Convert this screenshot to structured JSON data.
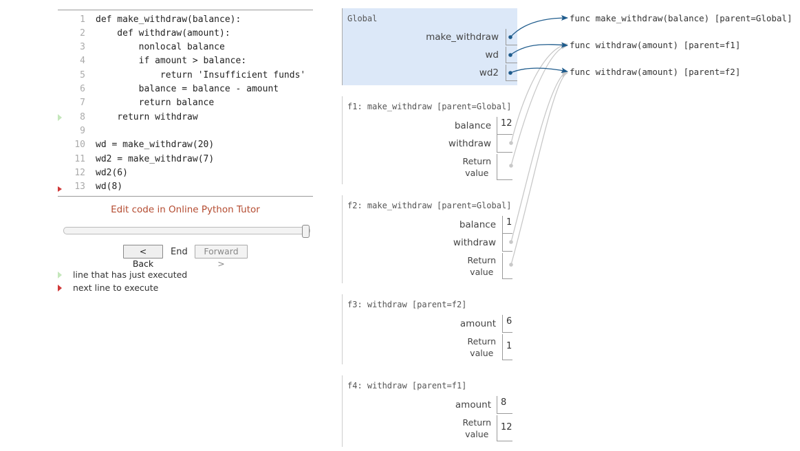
{
  "code": {
    "lines": [
      {
        "no": "1",
        "text": "def make_withdraw(balance):"
      },
      {
        "no": "2",
        "text": "    def withdraw(amount):"
      },
      {
        "no": "3",
        "text": "        nonlocal balance"
      },
      {
        "no": "4",
        "text": "        if amount > balance:"
      },
      {
        "no": "5",
        "text": "            return 'Insufficient funds'"
      },
      {
        "no": "6",
        "text": "        balance = balance - amount"
      },
      {
        "no": "7",
        "text": "        return balance"
      },
      {
        "no": "8",
        "text": "    return withdraw"
      },
      {
        "no": "9",
        "text": ""
      },
      {
        "no": "10",
        "text": "wd = make_withdraw(20)"
      },
      {
        "no": "11",
        "text": "wd2 = make_withdraw(7)"
      },
      {
        "no": "12",
        "text": "wd2(6)"
      },
      {
        "no": "13",
        "text": "wd(8)"
      }
    ]
  },
  "edit_link": "Edit code in Online Python Tutor",
  "nav": {
    "back": "< Back",
    "status": "End",
    "forward": "Forward >",
    "progress": 1.0
  },
  "legend": {
    "just_executed": "line that has just executed",
    "next_line": "next line to execute"
  },
  "frames": {
    "global": {
      "title": "Global",
      "vars": [
        "make_withdraw",
        "wd",
        "wd2"
      ]
    },
    "f1": {
      "title": "f1: make_withdraw [parent=Global]",
      "balance_label": "balance",
      "balance_value": "12",
      "withdraw_label": "withdraw",
      "return_label_1": "Return",
      "return_label_2": "value"
    },
    "f2": {
      "title": "f2: make_withdraw [parent=Global]",
      "balance_label": "balance",
      "balance_value": "1",
      "withdraw_label": "withdraw",
      "return_label_1": "Return",
      "return_label_2": "value"
    },
    "f3": {
      "title": "f3: withdraw [parent=f2]",
      "amount_label": "amount",
      "amount_value": "6",
      "return_label_1": "Return",
      "return_label_2": "value",
      "return_value": "1"
    },
    "f4": {
      "title": "f4: withdraw [parent=f1]",
      "amount_label": "amount",
      "amount_value": "8",
      "return_label_1": "Return",
      "return_label_2": "value",
      "return_value": "12"
    }
  },
  "objects": {
    "make_withdraw_func": "func make_withdraw(balance) [parent=Global]",
    "withdraw_f1_func": "func withdraw(amount) [parent=f1]",
    "withdraw_f2_func": "func withdraw(amount) [parent=f2]"
  },
  "colors": {
    "arrow_active": "#1e5b8c",
    "arrow_inactive": "#c8c8c8",
    "global_bg": "#dce8f8",
    "link": "#b44b30",
    "just_executed": "#c4e7bb",
    "next_line": "#d03939"
  }
}
